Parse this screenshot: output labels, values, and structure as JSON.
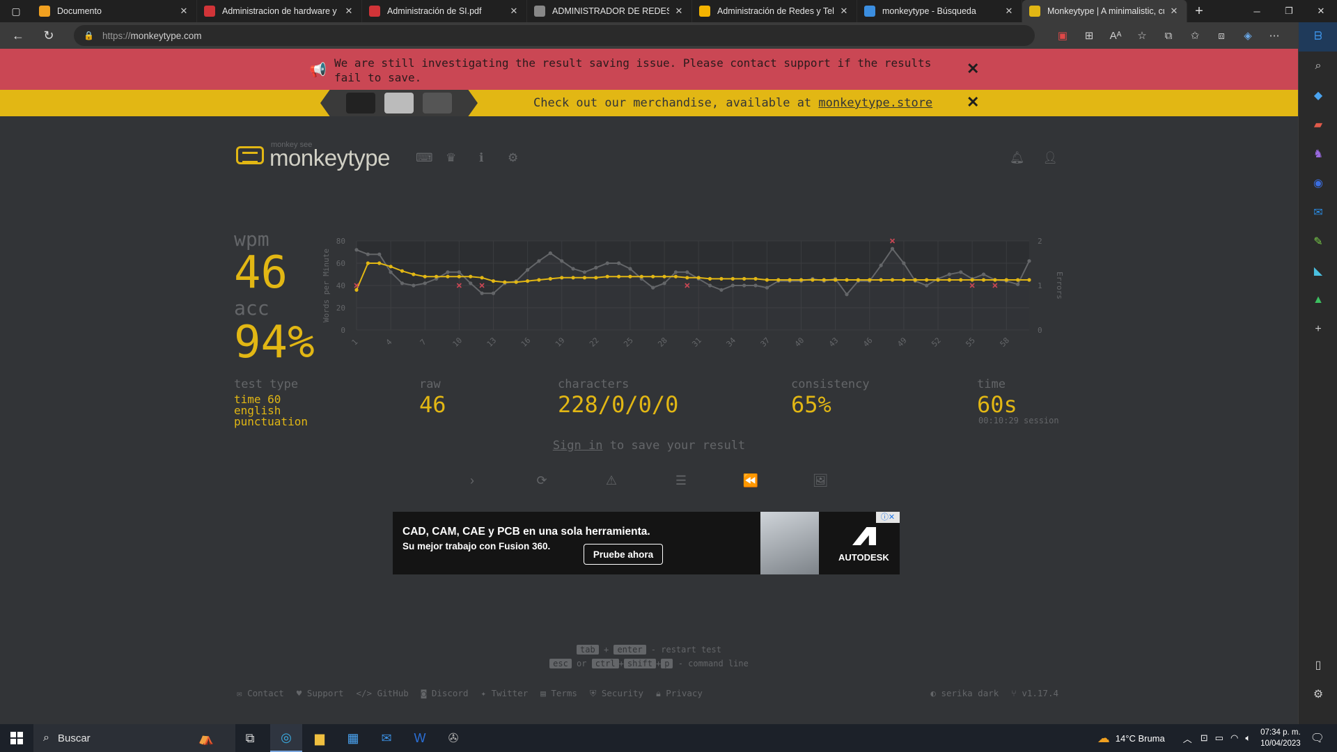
{
  "browser": {
    "tabs": [
      {
        "title": "Documento",
        "favicon": "doc-icon",
        "color": "#f0a020"
      },
      {
        "title": "Administracion de hardware y sc",
        "favicon": "pdf-icon",
        "color": "#d13438"
      },
      {
        "title": "Administración de SI.pdf",
        "favicon": "pdf-icon",
        "color": "#d13438"
      },
      {
        "title": "ADMINISTRADOR DE REDES Y C",
        "favicon": "globe-icon",
        "color": "#888888"
      },
      {
        "title": "Administración de Redes y Telec",
        "favicon": "slides-icon",
        "color": "#f4b400"
      },
      {
        "title": "monkeytype - Búsqueda",
        "favicon": "search-icon",
        "color": "#3b8ee0"
      },
      {
        "title": "Monkeytype | A minimalistic, cu",
        "favicon": "monkeytype-icon",
        "color": "#e2b714"
      }
    ],
    "active_tab": 6,
    "url_protocol": "https://",
    "url_host": "monkeytype.com"
  },
  "notices": {
    "investigating": "We are still investigating the result saving issue. Please contact support if the results fail to save.",
    "merch_prefix": "Check out our merchandise, available at ",
    "merch_link": "monkeytype.store"
  },
  "header": {
    "logo_small": "monkey see",
    "logo_text": "monkeytype"
  },
  "result": {
    "wpm_label": "wpm",
    "wpm": "46",
    "acc_label": "acc",
    "acc": "94%",
    "test_type_label": "test type",
    "test_type": [
      "time 60",
      "english",
      "punctuation"
    ],
    "raw_label": "raw",
    "raw": "46",
    "characters_label": "characters",
    "characters": "228/0/0/0",
    "consistency_label": "consistency",
    "consistency": "65%",
    "time_label": "time",
    "time": "60s",
    "session": "00:10:29 session"
  },
  "signin": {
    "link": "Sign in",
    "rest": " to save your result"
  },
  "ad": {
    "headline": "CAD, CAM, CAE y PCB en una sola herramienta.",
    "sub": "Su mejor trabajo con Fusion 360.",
    "button": "Pruebe ahora",
    "brand": "AUTODESK"
  },
  "hints": {
    "tab": "tab",
    "plus1": "+",
    "enter": "enter",
    "restart": "- restart test",
    "esc": "esc",
    "or": "or",
    "ctrl": "ctrl",
    "shift": "shift",
    "p": "p",
    "command": "- command line"
  },
  "footer": {
    "links": [
      "Contact",
      "Support",
      "GitHub",
      "Discord",
      "Twitter",
      "Terms",
      "Security",
      "Privacy"
    ],
    "theme": "serika dark",
    "version": "v1.17.4"
  },
  "taskbar": {
    "search": "Buscar",
    "weather": "14°C  Bruma",
    "time": "07:34 p. m.",
    "date": "10/04/2023"
  },
  "colors": {
    "bg": "#323437",
    "main": "#e2b714",
    "sub": "#646669",
    "error": "#ca4754"
  },
  "chart_data": {
    "type": "line",
    "ylabel": "Words per Minute",
    "ylabel_right": "Errors",
    "ylim": [
      0,
      80
    ],
    "ylim_right": [
      0,
      2
    ],
    "yticks": [
      0,
      20,
      40,
      60,
      80
    ],
    "yticks_right": [
      0,
      1,
      2
    ],
    "xticks": [
      1,
      4,
      7,
      10,
      13,
      16,
      19,
      22,
      25,
      28,
      31,
      34,
      37,
      40,
      43,
      46,
      49,
      52,
      55,
      58
    ],
    "x": [
      1,
      2,
      3,
      4,
      5,
      6,
      7,
      8,
      9,
      10,
      11,
      12,
      13,
      14,
      15,
      16,
      17,
      18,
      19,
      20,
      21,
      22,
      23,
      24,
      25,
      26,
      27,
      28,
      29,
      30,
      31,
      32,
      33,
      34,
      35,
      36,
      37,
      38,
      39,
      40,
      41,
      42,
      43,
      44,
      45,
      46,
      47,
      48,
      49,
      50,
      51,
      52,
      53,
      54,
      55,
      56,
      57,
      58,
      59,
      60
    ],
    "series": [
      {
        "name": "wpm",
        "color": "#e2b714",
        "values": [
          36,
          60,
          60,
          57,
          53,
          50,
          48,
          48,
          48,
          48,
          48,
          47,
          44,
          43,
          43,
          44,
          45,
          46,
          47,
          47,
          47,
          47,
          48,
          48,
          48,
          48,
          48,
          48,
          48,
          47,
          47,
          46,
          46,
          46,
          46,
          46,
          45,
          45,
          45,
          45,
          45,
          45,
          45,
          45,
          45,
          45,
          45,
          45,
          45,
          45,
          45,
          45,
          45,
          45,
          45,
          45,
          45,
          45,
          45,
          45
        ]
      },
      {
        "name": "raw",
        "color": "#646669",
        "values": [
          72,
          68,
          68,
          52,
          42,
          40,
          42,
          46,
          52,
          52,
          42,
          33,
          33,
          42,
          44,
          54,
          62,
          69,
          62,
          55,
          52,
          56,
          60,
          60,
          55,
          46,
          38,
          42,
          52,
          52,
          46,
          40,
          36,
          40,
          40,
          40,
          38,
          44,
          44,
          44,
          46,
          44,
          46,
          32,
          44,
          44,
          58,
          73,
          60,
          44,
          40,
          46,
          50,
          52,
          46,
          50,
          45,
          44,
          41,
          62
        ]
      }
    ],
    "errors": [
      {
        "x": 1,
        "y": 1
      },
      {
        "x": 10,
        "y": 1
      },
      {
        "x": 12,
        "y": 1
      },
      {
        "x": 30,
        "y": 1
      },
      {
        "x": 48,
        "y": 2
      },
      {
        "x": 55,
        "y": 1
      },
      {
        "x": 57,
        "y": 1
      }
    ]
  }
}
